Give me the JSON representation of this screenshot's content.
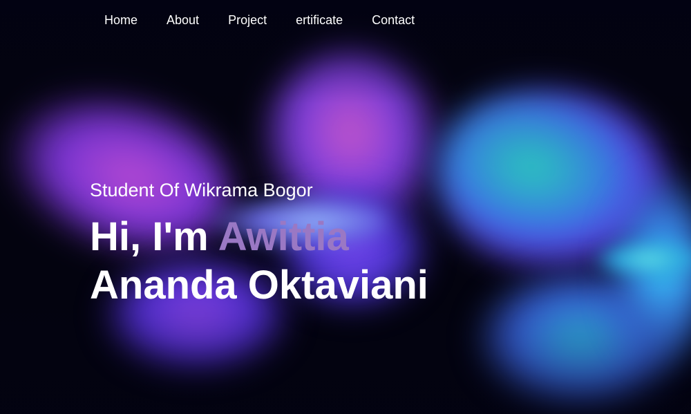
{
  "nav": {
    "items": [
      {
        "label": "Home"
      },
      {
        "label": "About"
      },
      {
        "label": "Project"
      },
      {
        "label": "ertificate"
      },
      {
        "label": "Contact"
      }
    ]
  },
  "hero": {
    "subtitle": "Student Of Wikrama Bogor",
    "greeting": "Hi, I'm",
    "name_highlight": "Awittia",
    "name_rest": "Ananda Oktaviani",
    "accent_color": "#9a78c4",
    "background_image": "blurred glowing butterflies (purple, blue, cyan) on dark background"
  }
}
